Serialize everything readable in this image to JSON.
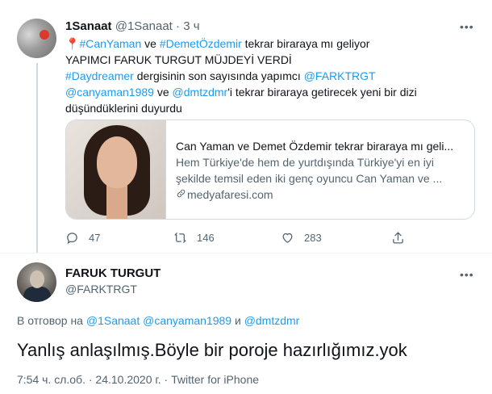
{
  "tweet1": {
    "display_name": "1Sanaat",
    "handle": "@1Sanaat",
    "separator": "·",
    "time": "3 ч",
    "more": "•••",
    "line1": {
      "emoji": "📍",
      "hashtag1": "#CanYaman",
      "word1": " ve ",
      "hashtag2": "#DemetÖzdemir",
      "rest": " tekrar biraraya mı geliyor"
    },
    "line2": "YAPIMCI FARUK TURGUT MÜJDEYİ VERDİ",
    "line3": {
      "hashtag": "#Daydreamer",
      "rest": " dergisinin son sayısında yapımcı ",
      "mention": "@FARKTRGT"
    },
    "line4": {
      "mention1": "@canyaman1989",
      "word": " ve ",
      "mention2": "@dmtzdmr",
      "rest": "'i tekrar biraraya getirecek yeni bir dizi"
    },
    "line5": "düşündüklerini duyurdu",
    "card": {
      "title": "Can Yaman ve Demet Özdemir tekrar biraraya mı geli...",
      "description_line1": "Hem Türkiye'de hem de yurtdışında Türkiye'yi en iyi",
      "description_line2": "şekilde temsil eden iki genç oyuncu Can Yaman ve ...",
      "domain": "medyafaresi.com"
    },
    "actions": {
      "replies": "47",
      "retweets": "146",
      "likes": "283"
    }
  },
  "tweet2": {
    "display_name": "FARUK TURGUT",
    "handle": "@FARKTRGT",
    "more": "•••",
    "replying": {
      "prefix": "В отговор на ",
      "mention1": "@1Sanaat",
      "mention2": "@canyaman1989",
      "conj": " и ",
      "mention3": "@dmtzdmr"
    },
    "text": "Yanlış anlaşılmış.Böyle bir poroje hazırlığımız.yok",
    "meta": "7:54 ч. сл.об. · 24.10.2020 г. · Twitter for iPhone"
  }
}
